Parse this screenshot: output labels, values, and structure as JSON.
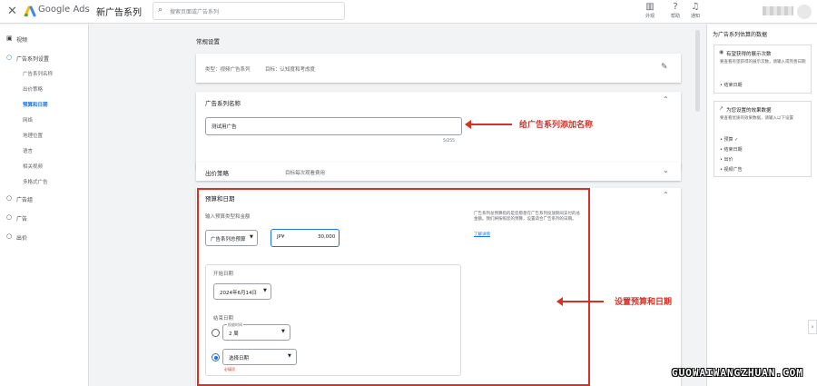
{
  "topbar": {
    "close_glyph": "✕",
    "brand": "Google Ads",
    "page_title": "新广告系列",
    "search_placeholder": "搜索页面或广告系列",
    "buttons": [
      {
        "label": "外观",
        "icon": "appearance-icon",
        "glyph": "▥"
      },
      {
        "label": "帮助",
        "icon": "help-icon",
        "glyph": "?"
      },
      {
        "label": "通知",
        "icon": "bell-icon",
        "glyph": "🔔"
      }
    ]
  },
  "sidebar": {
    "items": [
      {
        "label": "视频",
        "glyph": "▣"
      },
      {
        "label": "广告系列设置",
        "glyph": "○"
      }
    ],
    "sub_items": [
      "广告系列名称",
      "出价策略",
      "预算和日期",
      "网络",
      "地理位置",
      "语言",
      "相关视频",
      "多格式广告"
    ],
    "active_sub": "预算和日期",
    "bottom_items": [
      {
        "label": "广告组",
        "glyph": "○"
      },
      {
        "label": "广告",
        "glyph": "○"
      },
      {
        "label": "出价",
        "glyph": "○"
      }
    ]
  },
  "main": {
    "section_title": "常规设置",
    "type_card": {
      "type_text": "类型：视频广告系列",
      "goal_text": "目标：认知度和考虑度",
      "edit_glyph": "✎"
    },
    "name_card": {
      "title": "广告系列名称",
      "value": "测试用广告",
      "counter": "5/255",
      "chevron": "^"
    },
    "bid_card": {
      "title": "出价策略",
      "value": "目标每次观看费用",
      "chevron": "v"
    },
    "budget_card": {
      "title": "预算和日期",
      "chevron": "^",
      "budget_label": "输入预算类型和金额",
      "budget_type": "广告系列总预算",
      "currency": "JP¥",
      "amount": "30,000",
      "help_text": "广告系列总预算指的是您愿意在广告系列投放期间支付的总金额。我们将按照您的预算，设置适合广告系列的日期。",
      "learn_more": "了解详情",
      "start_label": "开始日期",
      "start_date": "2024年6月14日",
      "end_label": "结束日期",
      "duration_label": "投放时间",
      "duration_value": "2 周",
      "select_date": "选择日期",
      "required": "必填项"
    }
  },
  "annotations": {
    "name": "给广告系列添加名称",
    "budget": "设置预算和日期"
  },
  "right_panel": {
    "title": "为广告系列估算的数据",
    "card1": {
      "heading": "有望获得的展示次数",
      "desc": "要查看有望获得的展示次数，请输入或完善日期",
      "items": [
        "结束日期"
      ]
    },
    "card2": {
      "heading": "为您设置的效果数据",
      "desc": "要查看优质的效果数据，请输入以下设置",
      "items": [
        "预算 ✓",
        "结束日期",
        "出价",
        "视频广告"
      ]
    }
  },
  "watermark": "GUOWAIWANGZHUAN.COM",
  "colors": {
    "accent": "#1a73e8",
    "annotation_red": "#d93025"
  }
}
